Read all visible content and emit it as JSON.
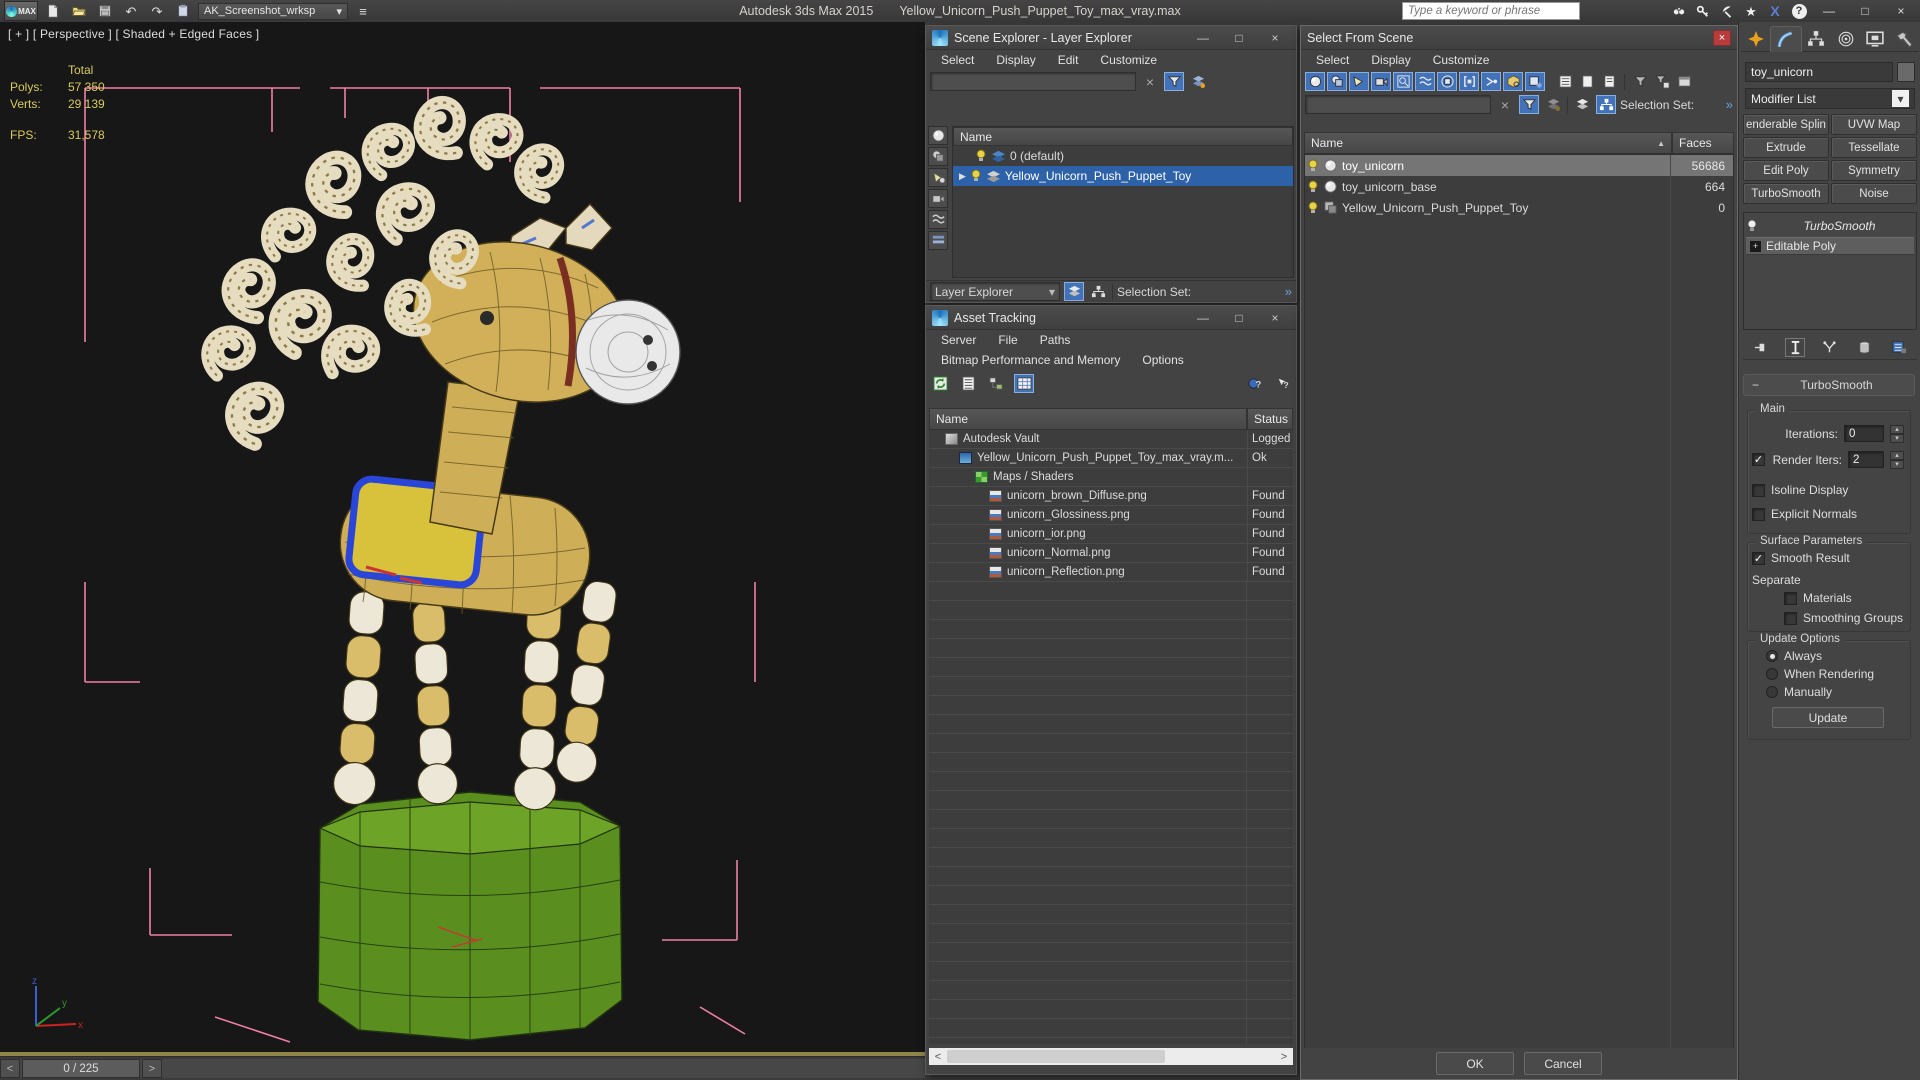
{
  "colors": {
    "accent-blue": "#4273b8",
    "selection-blue": "#2e62a8",
    "stats-yellow": "#d8cb5e",
    "pink": "#ef7fa7",
    "base-green": "#5a8e1e",
    "toy-tan": "#cfae58",
    "close-red": "#b83c3c"
  },
  "icons": {
    "close": "×",
    "minimize": "—",
    "maximize": "□",
    "clear": "×",
    "sort_asc": "▲",
    "chevron_down": "▾",
    "expand": "▶",
    "spin_up": "▴",
    "spin_down": "▾",
    "left": "<",
    "right": ">",
    "more": "»",
    "check": "✓",
    "undo": "↶",
    "redo": "↷",
    "star": "★",
    "help": "?",
    "plus": "+",
    "minus": "−",
    "x_letter": "X"
  },
  "titlebar": {
    "logo_label": "MAX",
    "workspace": "AK_Screenshot_wrksp",
    "app_title": "Autodesk 3ds Max  2015",
    "file_title": "Yellow_Unicorn_Push_Puppet_Toy_max_vray.max",
    "search_placeholder": "Type a keyword or phrase"
  },
  "viewport": {
    "label": "[ + ] [ Perspective ] [ Shaded + Edged Faces ]",
    "stats": {
      "total": "Total",
      "polys_label": "Polys:",
      "polys": "57 350",
      "verts_label": "Verts:",
      "verts": "29 139",
      "fps_label": "FPS:",
      "fps": "31,578"
    },
    "axis": {
      "x": "x",
      "y": "y",
      "z": "z"
    },
    "time_thumb": "0 / 225"
  },
  "scene_explorer": {
    "title": "Scene Explorer - Layer Explorer",
    "menus": [
      "Select",
      "Display",
      "Edit",
      "Customize"
    ],
    "search_value": "",
    "name_header": "Name",
    "rows": [
      {
        "label": "0 (default)"
      },
      {
        "label": "Yellow_Unicorn_Push_Puppet_Toy"
      }
    ],
    "mode": "Layer Explorer",
    "selection_set": "Selection Set:"
  },
  "asset_tracking": {
    "title": "Asset Tracking",
    "menus": [
      "Server",
      "File",
      "Paths",
      "Bitmap Performance and Memory",
      "Options"
    ],
    "col_name": "Name",
    "col_status": "Status",
    "rows": [
      {
        "name": "Autodesk Vault",
        "status": "Logged"
      },
      {
        "name": "Yellow_Unicorn_Push_Puppet_Toy_max_vray.m...",
        "status": "Ok"
      },
      {
        "name": "Maps / Shaders",
        "status": ""
      },
      {
        "name": "unicorn_brown_Diffuse.png",
        "status": "Found"
      },
      {
        "name": "unicorn_Glossiness.png",
        "status": "Found"
      },
      {
        "name": "unicorn_ior.png",
        "status": "Found"
      },
      {
        "name": "unicorn_Normal.png",
        "status": "Found"
      },
      {
        "name": "unicorn_Reflection.png",
        "status": "Found"
      }
    ]
  },
  "select_from_scene": {
    "title": "Select From Scene",
    "menus": [
      "Select",
      "Display",
      "Customize"
    ],
    "selection_set": "Selection Set:",
    "col_name": "Name",
    "col_faces": "Faces",
    "rows": [
      {
        "name": "toy_unicorn",
        "faces": "56686"
      },
      {
        "name": "toy_unicorn_base",
        "faces": "664"
      },
      {
        "name": "Yellow_Unicorn_Push_Puppet_Toy",
        "faces": "0"
      }
    ],
    "ok": "OK",
    "cancel": "Cancel"
  },
  "command_panel": {
    "object_name": "toy_unicorn",
    "modifier_list": "Modifier List",
    "buttons": [
      "enderable Splin",
      "UVW Map",
      "Extrude",
      "Tessellate",
      "Edit Poly",
      "Symmetry",
      "TurboSmooth",
      "Noise"
    ],
    "stack": {
      "turbosmooth": "TurboSmooth",
      "editable_poly": "Editable Poly"
    },
    "rollout": {
      "title": "TurboSmooth",
      "main": "Main",
      "iterations": "Iterations:",
      "iterations_value": "0",
      "render_iters": "Render Iters:",
      "render_iters_value": "2",
      "isoline": "Isoline Display",
      "explicit": "Explicit Normals",
      "surface": "Surface Parameters",
      "smooth_result": "Smooth Result",
      "separate": "Separate",
      "materials": "Materials",
      "smoothing_groups": "Smoothing Groups",
      "update_options": "Update Options",
      "always": "Always",
      "when_rendering": "When Rendering",
      "manually": "Manually",
      "update": "Update"
    }
  }
}
